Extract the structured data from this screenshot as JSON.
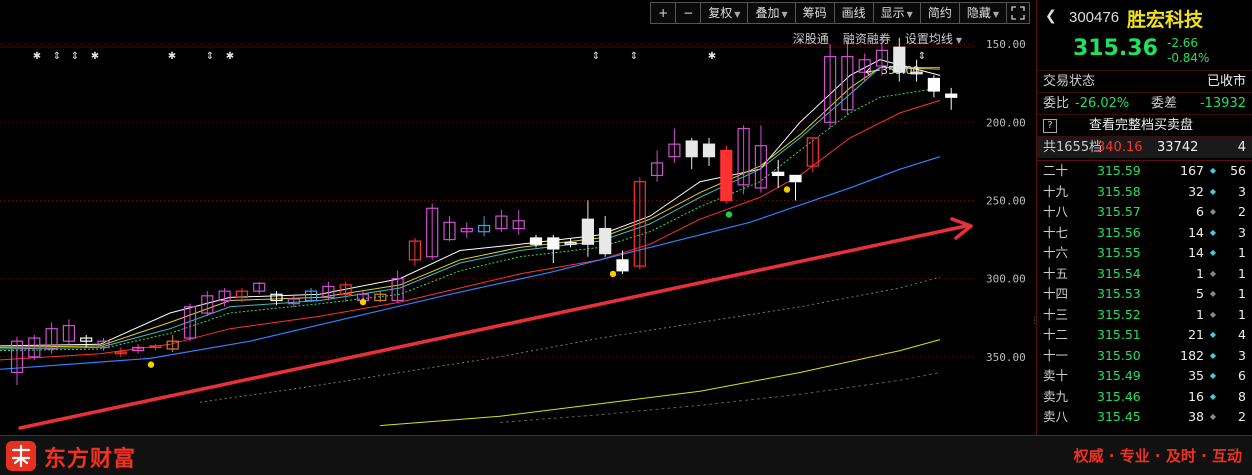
{
  "toolbar": {
    "plus": "+",
    "minus": "−",
    "fuquan": "复权",
    "diejia": "叠加",
    "chouma": "筹码",
    "huaxian": "画线",
    "xianshi": "显示",
    "jianyue": "简约",
    "yincang": "隐藏"
  },
  "subtoolbar": {
    "shengutong": "深股通",
    "rongzi": "融资融券",
    "junxian": "设置均线"
  },
  "chart": {
    "peak_label": "355.00",
    "y_ticks": [
      "350.00",
      "300.00",
      "250.00",
      "200.00",
      "150.00"
    ]
  },
  "chart_data": {
    "type": "candlestick",
    "ylim": [
      100,
      375
    ],
    "y_ticks": [
      150,
      200,
      250,
      300,
      350
    ],
    "annotations": [
      "355.00"
    ]
  },
  "quote": {
    "code": "300476",
    "name": "胜宏科技",
    "price": "315.36",
    "change": "-2.66",
    "change_pct": "-0.84%",
    "status_label": "交易状态",
    "status_value": "已收市",
    "weibi_label": "委比",
    "weibi_value": "-26.02%",
    "weicha_label": "委差",
    "weicha_value": "-13932",
    "help": "?",
    "view_book": "查看完整档买卖盘",
    "total_label": "共1655档",
    "total_price": "340.16",
    "total_vol": "33742",
    "total_cnt": "4"
  },
  "orderbook": [
    {
      "level": "二十",
      "price": "315.59",
      "vol": "167",
      "cnt": "56",
      "dot": "#40d0e0"
    },
    {
      "level": "十九",
      "price": "315.58",
      "vol": "32",
      "cnt": "3",
      "dot": "#40d0e0"
    },
    {
      "level": "十八",
      "price": "315.57",
      "vol": "6",
      "cnt": "2",
      "dot": "#888888"
    },
    {
      "level": "十七",
      "price": "315.56",
      "vol": "14",
      "cnt": "3",
      "dot": "#40d0e0"
    },
    {
      "level": "十六",
      "price": "315.55",
      "vol": "14",
      "cnt": "1",
      "dot": "#40d0e0"
    },
    {
      "level": "十五",
      "price": "315.54",
      "vol": "1",
      "cnt": "1",
      "dot": "#888888"
    },
    {
      "level": "十四",
      "price": "315.53",
      "vol": "5",
      "cnt": "1",
      "dot": "#888888"
    },
    {
      "level": "十三",
      "price": "315.52",
      "vol": "1",
      "cnt": "1",
      "dot": "#888888"
    },
    {
      "level": "十二",
      "price": "315.51",
      "vol": "21",
      "cnt": "4",
      "dot": "#40d0e0"
    },
    {
      "level": "十一",
      "price": "315.50",
      "vol": "182",
      "cnt": "3",
      "dot": "#40d0e0"
    },
    {
      "level": "卖十",
      "price": "315.49",
      "vol": "35",
      "cnt": "6",
      "dot": "#40d0e0"
    },
    {
      "level": "卖九",
      "price": "315.46",
      "vol": "16",
      "cnt": "8",
      "dot": "#40d0e0"
    },
    {
      "level": "卖八",
      "price": "315.45",
      "vol": "38",
      "cnt": "2",
      "dot": "#888888"
    }
  ],
  "footer": {
    "logo_text": "东方财富",
    "slogan": "权威 · 专业 · 及时 · 互动"
  }
}
